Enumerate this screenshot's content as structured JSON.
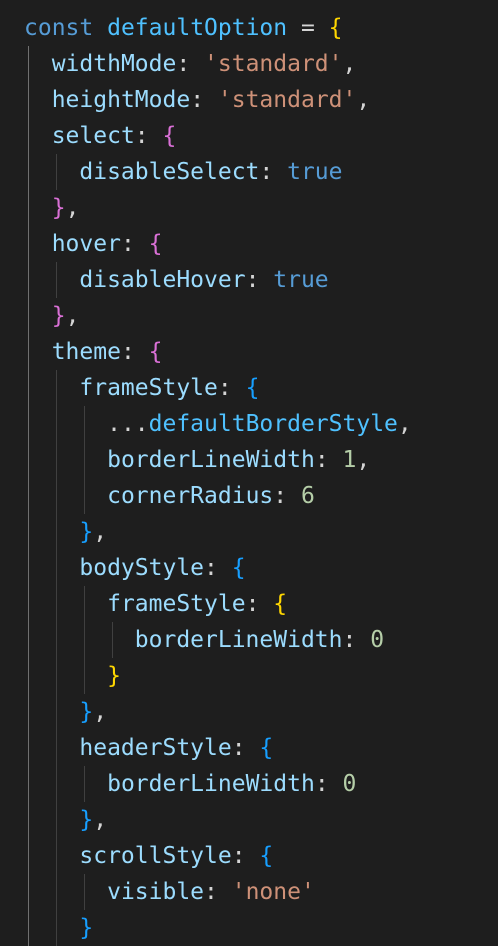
{
  "editor": {
    "lines": [
      [
        {
          "t": "const",
          "c": "kw"
        },
        {
          "t": " ",
          "c": "punc"
        },
        {
          "t": "defaultOption",
          "c": "var"
        },
        {
          "t": " = ",
          "c": "punc"
        },
        {
          "t": "{",
          "c": "b1"
        }
      ],
      [
        {
          "t": "  ",
          "c": "punc"
        },
        {
          "t": "widthMode",
          "c": "prop"
        },
        {
          "t": ": ",
          "c": "punc"
        },
        {
          "t": "'standard'",
          "c": "str"
        },
        {
          "t": ",",
          "c": "punc"
        }
      ],
      [
        {
          "t": "  ",
          "c": "punc"
        },
        {
          "t": "heightMode",
          "c": "prop"
        },
        {
          "t": ": ",
          "c": "punc"
        },
        {
          "t": "'standard'",
          "c": "str"
        },
        {
          "t": ",",
          "c": "punc"
        }
      ],
      [
        {
          "t": "  ",
          "c": "punc"
        },
        {
          "t": "select",
          "c": "prop"
        },
        {
          "t": ": ",
          "c": "punc"
        },
        {
          "t": "{",
          "c": "b2"
        }
      ],
      [
        {
          "t": "    ",
          "c": "punc"
        },
        {
          "t": "disableSelect",
          "c": "prop"
        },
        {
          "t": ": ",
          "c": "punc"
        },
        {
          "t": "true",
          "c": "bool"
        }
      ],
      [
        {
          "t": "  ",
          "c": "punc"
        },
        {
          "t": "}",
          "c": "b2"
        },
        {
          "t": ",",
          "c": "punc"
        }
      ],
      [
        {
          "t": "  ",
          "c": "punc"
        },
        {
          "t": "hover",
          "c": "prop"
        },
        {
          "t": ": ",
          "c": "punc"
        },
        {
          "t": "{",
          "c": "b2"
        }
      ],
      [
        {
          "t": "    ",
          "c": "punc"
        },
        {
          "t": "disableHover",
          "c": "prop"
        },
        {
          "t": ": ",
          "c": "punc"
        },
        {
          "t": "true",
          "c": "bool"
        }
      ],
      [
        {
          "t": "  ",
          "c": "punc"
        },
        {
          "t": "}",
          "c": "b2"
        },
        {
          "t": ",",
          "c": "punc"
        }
      ],
      [
        {
          "t": "  ",
          "c": "punc"
        },
        {
          "t": "theme",
          "c": "prop"
        },
        {
          "t": ": ",
          "c": "punc"
        },
        {
          "t": "{",
          "c": "b2"
        }
      ],
      [
        {
          "t": "    ",
          "c": "punc"
        },
        {
          "t": "frameStyle",
          "c": "prop"
        },
        {
          "t": ": ",
          "c": "punc"
        },
        {
          "t": "{",
          "c": "b3"
        }
      ],
      [
        {
          "t": "      ",
          "c": "punc"
        },
        {
          "t": "...",
          "c": "punc"
        },
        {
          "t": "defaultBorderStyle",
          "c": "var"
        },
        {
          "t": ",",
          "c": "punc"
        }
      ],
      [
        {
          "t": "      ",
          "c": "punc"
        },
        {
          "t": "borderLineWidth",
          "c": "prop"
        },
        {
          "t": ": ",
          "c": "punc"
        },
        {
          "t": "1",
          "c": "num"
        },
        {
          "t": ",",
          "c": "punc"
        }
      ],
      [
        {
          "t": "      ",
          "c": "punc"
        },
        {
          "t": "cornerRadius",
          "c": "prop"
        },
        {
          "t": ": ",
          "c": "punc"
        },
        {
          "t": "6",
          "c": "num"
        }
      ],
      [
        {
          "t": "    ",
          "c": "punc"
        },
        {
          "t": "}",
          "c": "b3"
        },
        {
          "t": ",",
          "c": "punc"
        }
      ],
      [
        {
          "t": "    ",
          "c": "punc"
        },
        {
          "t": "bodyStyle",
          "c": "prop"
        },
        {
          "t": ": ",
          "c": "punc"
        },
        {
          "t": "{",
          "c": "b3"
        }
      ],
      [
        {
          "t": "      ",
          "c": "punc"
        },
        {
          "t": "frameStyle",
          "c": "prop"
        },
        {
          "t": ": ",
          "c": "punc"
        },
        {
          "t": "{",
          "c": "b1"
        }
      ],
      [
        {
          "t": "        ",
          "c": "punc"
        },
        {
          "t": "borderLineWidth",
          "c": "prop"
        },
        {
          "t": ": ",
          "c": "punc"
        },
        {
          "t": "0",
          "c": "num"
        }
      ],
      [
        {
          "t": "      ",
          "c": "punc"
        },
        {
          "t": "}",
          "c": "b1"
        }
      ],
      [
        {
          "t": "    ",
          "c": "punc"
        },
        {
          "t": "}",
          "c": "b3"
        },
        {
          "t": ",",
          "c": "punc"
        }
      ],
      [
        {
          "t": "    ",
          "c": "punc"
        },
        {
          "t": "headerStyle",
          "c": "prop"
        },
        {
          "t": ": ",
          "c": "punc"
        },
        {
          "t": "{",
          "c": "b3"
        }
      ],
      [
        {
          "t": "      ",
          "c": "punc"
        },
        {
          "t": "borderLineWidth",
          "c": "prop"
        },
        {
          "t": ": ",
          "c": "punc"
        },
        {
          "t": "0",
          "c": "num"
        }
      ],
      [
        {
          "t": "    ",
          "c": "punc"
        },
        {
          "t": "}",
          "c": "b3"
        },
        {
          "t": ",",
          "c": "punc"
        }
      ],
      [
        {
          "t": "    ",
          "c": "punc"
        },
        {
          "t": "scrollStyle",
          "c": "prop"
        },
        {
          "t": ": ",
          "c": "punc"
        },
        {
          "t": "{",
          "c": "b3"
        }
      ],
      [
        {
          "t": "      ",
          "c": "punc"
        },
        {
          "t": "visible",
          "c": "prop"
        },
        {
          "t": ": ",
          "c": "punc"
        },
        {
          "t": "'none'",
          "c": "str"
        }
      ],
      [
        {
          "t": "    ",
          "c": "punc"
        },
        {
          "t": "}",
          "c": "b3"
        }
      ]
    ]
  },
  "colors": {
    "background": "#1e1e1e",
    "keyword": "#569cd6",
    "variable": "#4fc1ff",
    "property": "#9cdcfe",
    "string": "#ce9178",
    "number": "#b5cea8",
    "bracket_level_1": "#ffd700",
    "bracket_level_2": "#da70d6",
    "bracket_level_3": "#179fff"
  }
}
